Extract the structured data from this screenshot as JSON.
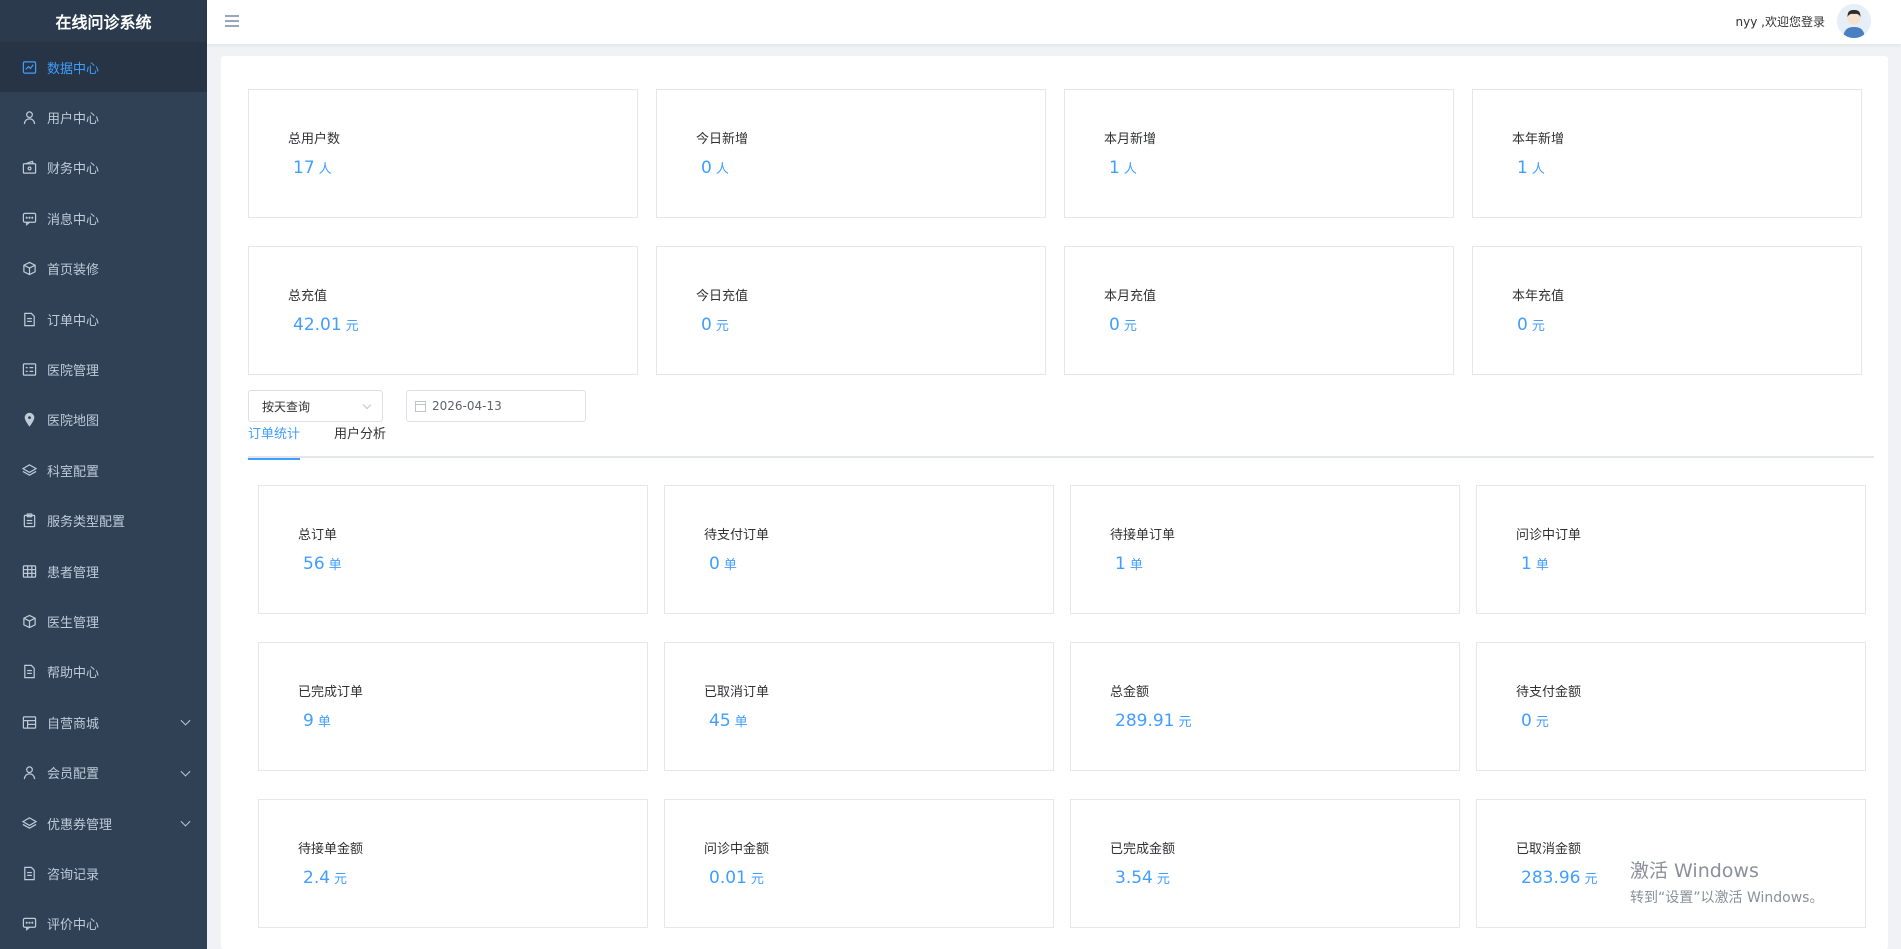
{
  "app": {
    "title": "在线问诊系统"
  },
  "sidebar": {
    "items": [
      {
        "label": "数据中心",
        "icon": "chart-icon",
        "active": true
      },
      {
        "label": "用户中心",
        "icon": "user-icon"
      },
      {
        "label": "财务中心",
        "icon": "wallet-icon"
      },
      {
        "label": "消息中心",
        "icon": "message-icon"
      },
      {
        "label": "首页装修",
        "icon": "box-icon"
      },
      {
        "label": "订单中心",
        "icon": "document-icon"
      },
      {
        "label": "医院管理",
        "icon": "list-icon"
      },
      {
        "label": "医院地图",
        "icon": "location-icon"
      },
      {
        "label": "科室配置",
        "icon": "layers-icon"
      },
      {
        "label": "服务类型配置",
        "icon": "clipboard-icon"
      },
      {
        "label": "患者管理",
        "icon": "grid-icon"
      },
      {
        "label": "医生管理",
        "icon": "box-icon"
      },
      {
        "label": "帮助中心",
        "icon": "document-icon"
      },
      {
        "label": "自营商城",
        "icon": "shop-icon",
        "expandable": true
      },
      {
        "label": "会员配置",
        "icon": "user-icon",
        "expandable": true
      },
      {
        "label": "优惠券管理",
        "icon": "layers-icon",
        "expandable": true
      },
      {
        "label": "咨询记录",
        "icon": "document-icon"
      },
      {
        "label": "评价中心",
        "icon": "message-icon"
      }
    ]
  },
  "header": {
    "welcome": "nyy ,欢迎您登录"
  },
  "user_stats": [
    {
      "label": "总用户数",
      "value": "17",
      "unit": "人"
    },
    {
      "label": "今日新增",
      "value": "0",
      "unit": "人"
    },
    {
      "label": "本月新增",
      "value": "1",
      "unit": "人"
    },
    {
      "label": "本年新增",
      "value": "1",
      "unit": "人"
    }
  ],
  "recharge_stats": [
    {
      "label": "总充值",
      "value": "42.01",
      "unit": "元"
    },
    {
      "label": "今日充值",
      "value": "0",
      "unit": "元"
    },
    {
      "label": "本月充值",
      "value": "0",
      "unit": "元"
    },
    {
      "label": "本年充值",
      "value": "0",
      "unit": "元"
    }
  ],
  "filters": {
    "mode": "按天查询",
    "date": "2026-04-13"
  },
  "tabs": [
    {
      "label": "订单统计",
      "active": true
    },
    {
      "label": "用户分析",
      "active": false
    }
  ],
  "order_stats": [
    {
      "label": "总订单",
      "value": "56",
      "unit": "单"
    },
    {
      "label": "待支付订单",
      "value": "0",
      "unit": "单"
    },
    {
      "label": "待接单订单",
      "value": "1",
      "unit": "单"
    },
    {
      "label": "问诊中订单",
      "value": "1",
      "unit": "单"
    },
    {
      "label": "已完成订单",
      "value": "9",
      "unit": "单"
    },
    {
      "label": "已取消订单",
      "value": "45",
      "unit": "单"
    },
    {
      "label": "总金额",
      "value": "289.91",
      "unit": "元"
    },
    {
      "label": "待支付金额",
      "value": "0",
      "unit": "元"
    },
    {
      "label": "待接单金额",
      "value": "2.4",
      "unit": "元"
    },
    {
      "label": "问诊中金额",
      "value": "0.01",
      "unit": "元"
    },
    {
      "label": "已完成金额",
      "value": "3.54",
      "unit": "元"
    },
    {
      "label": "已取消金额",
      "value": "283.96",
      "unit": "元"
    }
  ],
  "watermark": {
    "line1": "激活 Windows",
    "line2": "转到“设置”以激活 Windows。"
  },
  "colors": {
    "sidebar": "#304156",
    "accent": "#409eff",
    "active_bg": "#263445"
  }
}
